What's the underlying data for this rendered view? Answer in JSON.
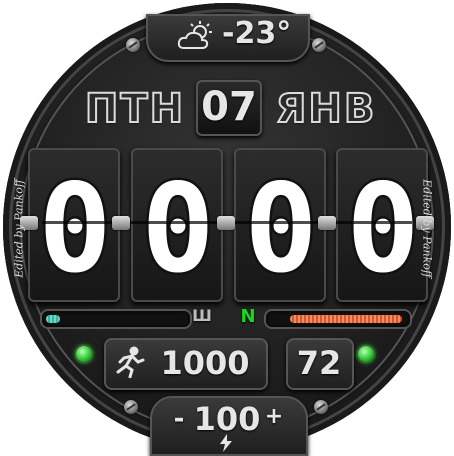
{
  "weather": {
    "icon": "partly-cloudy-icon",
    "temperature": "-23°"
  },
  "date": {
    "weekday": "ПТН",
    "day": "07",
    "month": "ЯНВ"
  },
  "time": {
    "digits": [
      "0",
      "0",
      "0",
      "0"
    ]
  },
  "indicators": {
    "left_bar_level": 0.1,
    "right_bar_level": 0.85,
    "left_bar_color": "#2fb8a0",
    "right_bar_color": "#e0521e",
    "middle_left": "Ш",
    "middle_right": "N"
  },
  "steps": {
    "icon": "running-person-icon",
    "value": "1000"
  },
  "heart_rate": {
    "value": "72"
  },
  "battery": {
    "minus": "-",
    "value": "100",
    "plus": "+",
    "icon": "lightning-icon"
  },
  "side_text": {
    "left": "Edited by Pankoff",
    "right": "Edited by Pankoff"
  },
  "colors": {
    "accent_green": "#1fd61f",
    "text": "#e6e6e6"
  }
}
